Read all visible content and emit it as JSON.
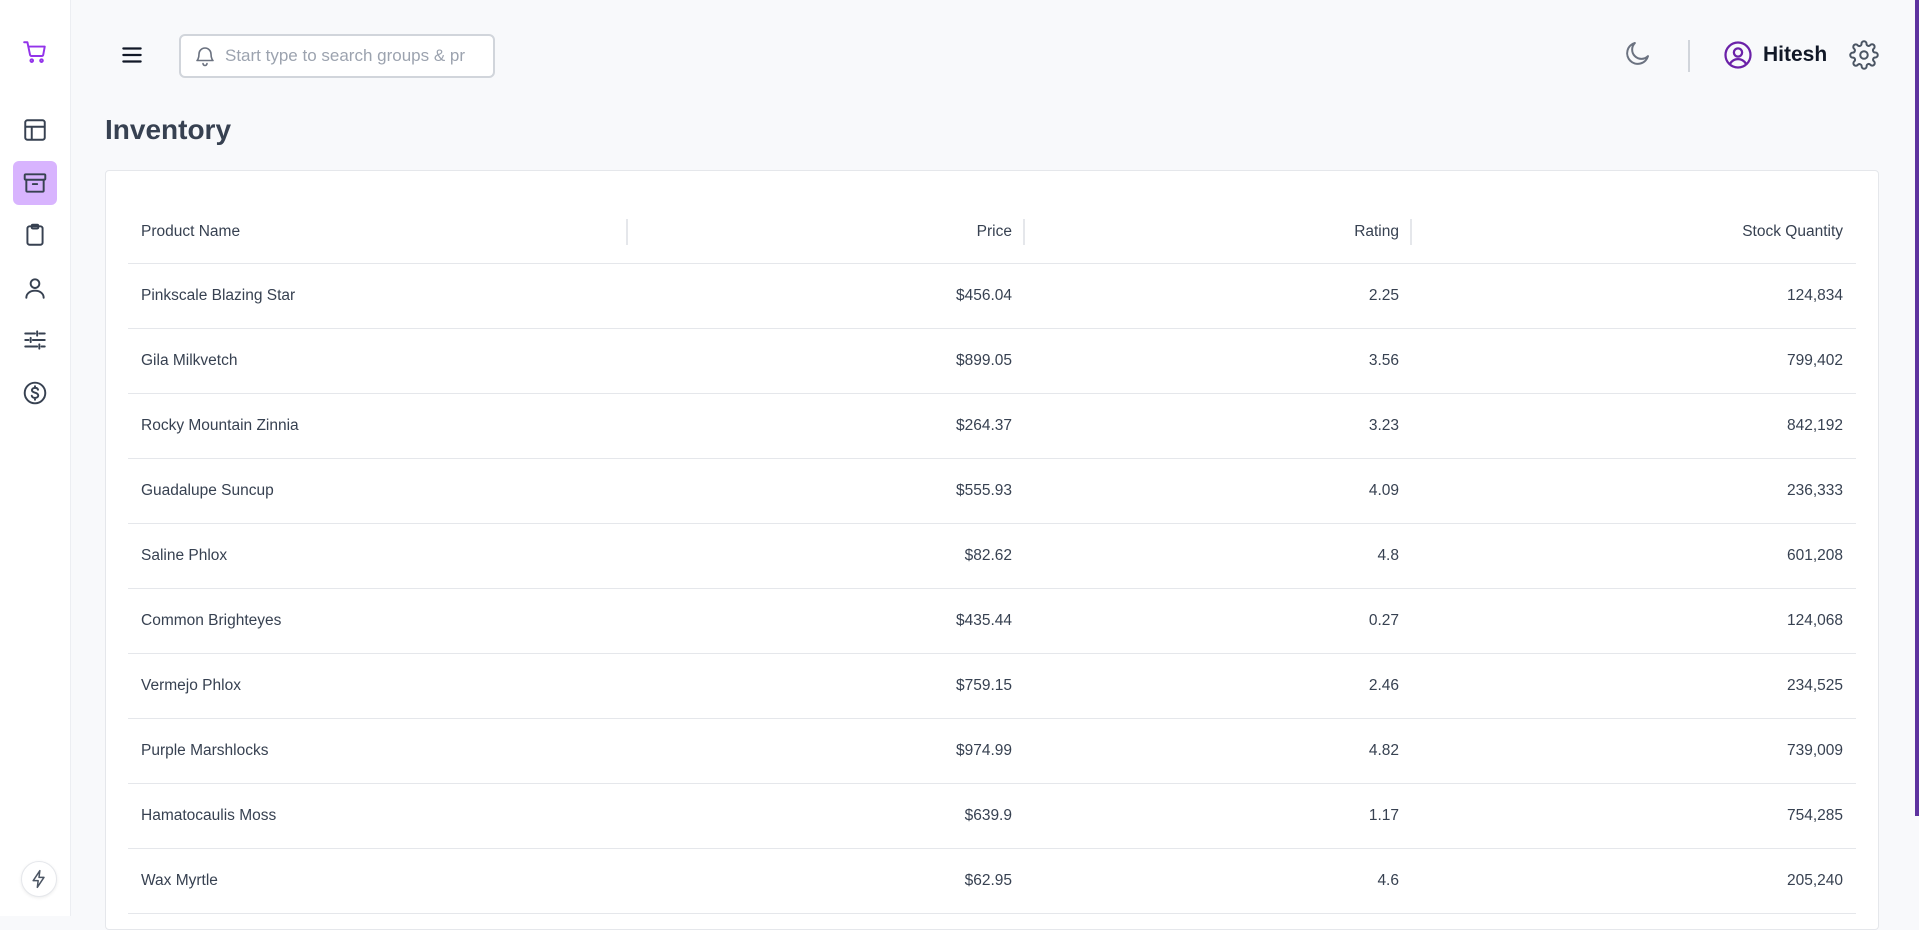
{
  "header": {
    "search": {
      "placeholder": "Start type to search groups & products",
      "value": ""
    },
    "user_name": "Hitesh"
  },
  "page": {
    "title": "Inventory"
  },
  "table": {
    "columns": [
      "Product Name",
      "Price",
      "Rating",
      "Stock Quantity"
    ],
    "rows": [
      [
        "Pinkscale Blazing Star",
        "$456.04",
        "2.25",
        "124,834"
      ],
      [
        "Gila Milkvetch",
        "$899.05",
        "3.56",
        "799,402"
      ],
      [
        "Rocky Mountain Zinnia",
        "$264.37",
        "3.23",
        "842,192"
      ],
      [
        "Guadalupe Suncup",
        "$555.93",
        "4.09",
        "236,333"
      ],
      [
        "Saline Phlox",
        "$82.62",
        "4.8",
        "601,208"
      ],
      [
        "Common Brighteyes",
        "$435.44",
        "0.27",
        "124,068"
      ],
      [
        "Vermejo Phlox",
        "$759.15",
        "2.46",
        "234,525"
      ],
      [
        "Purple Marshlocks",
        "$974.99",
        "4.82",
        "739,009"
      ],
      [
        "Hamatocaulis Moss",
        "$639.9",
        "1.17",
        "754,285"
      ],
      [
        "Wax Myrtle",
        "$62.95",
        "4.6",
        "205,240"
      ]
    ]
  },
  "sidebar": {
    "items": [
      {
        "icon": "shopping-cart-icon"
      },
      {
        "icon": "dashboard-layout-icon"
      },
      {
        "icon": "archive-box-icon",
        "active": true
      },
      {
        "icon": "clipboard-icon"
      },
      {
        "icon": "user-icon"
      },
      {
        "icon": "sliders-icon"
      },
      {
        "icon": "dollar-circle-icon"
      }
    ],
    "bottom_icon": "lightning-bolt-icon"
  },
  "colors": {
    "accent": "#9333ea",
    "active_bg": "#d8b4fe",
    "user_icon": "#6b21a8"
  }
}
